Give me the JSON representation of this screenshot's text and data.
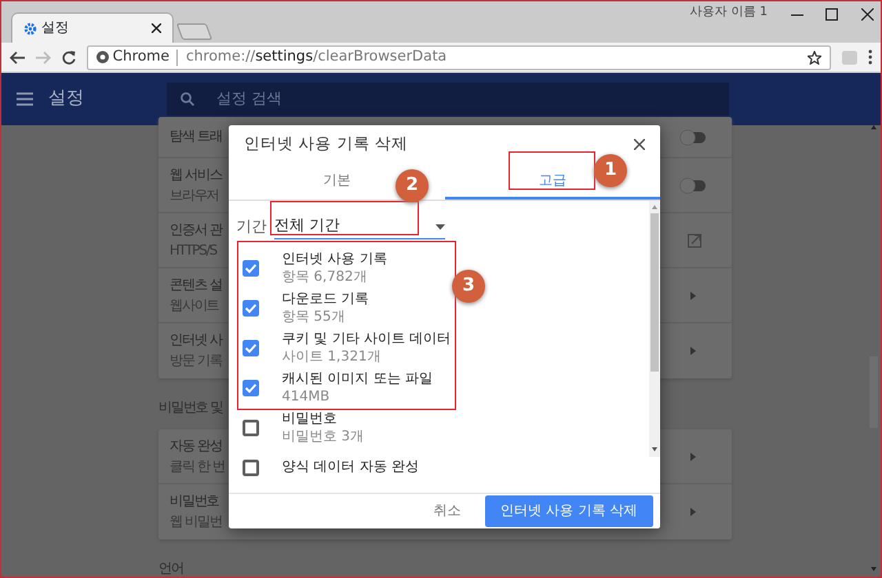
{
  "window": {
    "user_label": "사용자 이름 1"
  },
  "browser_tab": {
    "title": "설정"
  },
  "toolbar": {
    "forward_disabled": true,
    "site_label": "Chrome",
    "url_parts": [
      {
        "text": "chrome://",
        "emphasis": false
      },
      {
        "text": "settings",
        "emphasis": true
      },
      {
        "text": "/clearBrowserData",
        "emphasis": false
      }
    ]
  },
  "settings_header": {
    "title": "설정",
    "search_placeholder": "설정 검색"
  },
  "sections": [
    {
      "rows": [
        {
          "kind": "toggle",
          "on": false,
          "title": "탐색 트래"
        },
        {
          "kind": "toggle",
          "on": false,
          "title": "웹 서비스",
          "subtitle": "브라우저"
        },
        {
          "kind": "external",
          "title": "인증서 관",
          "subtitle": "HTTPS/S"
        },
        {
          "kind": "arrow",
          "title": "콘텐츠 설",
          "subtitle": "웹사이트"
        },
        {
          "kind": "arrow",
          "title": "인터넷 사",
          "subtitle": "방문 기록"
        }
      ]
    },
    {
      "heading": "비밀번호 및",
      "rows": [
        {
          "kind": "arrow",
          "title": "자동 완성",
          "subtitle": "클릭 한 번"
        },
        {
          "kind": "arrow",
          "title": "비밀번호",
          "subtitle": "웹 비밀번"
        }
      ]
    },
    {
      "heading": "언어"
    }
  ],
  "dialog": {
    "title": "인터넷 사용 기록 삭제",
    "tabs": [
      {
        "label": "기본",
        "selected": false
      },
      {
        "label": "고급",
        "selected": true
      }
    ],
    "period": {
      "label": "기간",
      "value": "전체 기간"
    },
    "items": [
      {
        "label": "인터넷 사용 기록",
        "detail": "항목 6,782개",
        "checked": true
      },
      {
        "label": "다운로드 기록",
        "detail": "항목 55개",
        "checked": true
      },
      {
        "label": "쿠키 및 기타 사이트 데이터",
        "detail": "사이트 1,321개",
        "checked": true
      },
      {
        "label": "캐시된 이미지 또는 파일",
        "detail": "414MB",
        "checked": true
      },
      {
        "label": "비밀번호",
        "detail": "비밀번호 3개",
        "checked": false
      },
      {
        "label": "양식 데이터 자동 완성",
        "checked": false
      }
    ],
    "cancel_button": "취소",
    "confirm_button": "인터넷 사용 기록 삭제"
  },
  "annotations": [
    {
      "label": "1"
    },
    {
      "label": "2"
    },
    {
      "label": "3"
    }
  ]
}
